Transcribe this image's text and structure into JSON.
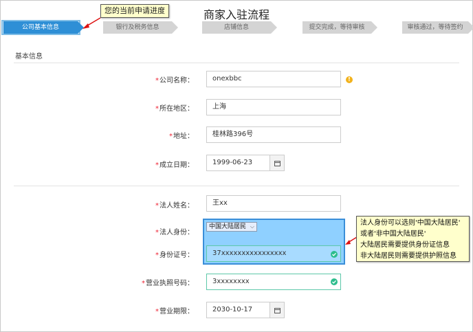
{
  "page": {
    "title": "商家入驻流程"
  },
  "tooltip": {
    "text": "您的当前申请进度"
  },
  "steps": [
    {
      "label": "公司基本信息",
      "active": true
    },
    {
      "label": "银行及税务信息",
      "active": false
    },
    {
      "label": "店铺信息",
      "active": false
    },
    {
      "label": "提交完成，等待审核",
      "active": false
    },
    {
      "label": "审核通过，等待签约",
      "active": false
    }
  ],
  "section": {
    "title": "基本信息"
  },
  "form": {
    "required_mark": "*",
    "company_name": {
      "label": "公司名称：",
      "value": "onexbbc"
    },
    "region": {
      "label": "所在地区：",
      "value": "上海"
    },
    "address": {
      "label": "地址：",
      "value": "桂林路396号"
    },
    "founded": {
      "label": "成立日期：",
      "value": "1999-06-23"
    },
    "legal_name": {
      "label": "法人姓名：",
      "value": "王xx"
    },
    "legal_identity": {
      "label": "法人身份：",
      "value": "中国大陆居民"
    },
    "id_number": {
      "label": "身份证号：",
      "value": "37xxxxxxxxxxxxxxxx"
    },
    "license_number": {
      "label": "营业执照号码：",
      "value": "3xxxxxxxx"
    },
    "business_term": {
      "label": "营业期限：",
      "value": "2030-10-17"
    }
  },
  "callout": {
    "lines": [
      "法人身份可以选则'中国大陆居民'",
      "或者'非中国大陆居民'",
      "大陆居民需要提供身份证信息",
      "非大陆居民则需要提供护照信息"
    ]
  },
  "colors": {
    "active_step": "#2e8fd6",
    "inactive_step": "#d4d4d4",
    "highlight": "#8fd0ff",
    "note_bg": "#ffffcc",
    "required": "#ee2233",
    "valid": "#2dbd8d",
    "warning": "#f2b21c"
  },
  "icons": {
    "warning": "warning-circle-icon",
    "calendar": "calendar-icon",
    "valid": "check-circle-icon",
    "select_chevron": "chevron-down-icon"
  }
}
